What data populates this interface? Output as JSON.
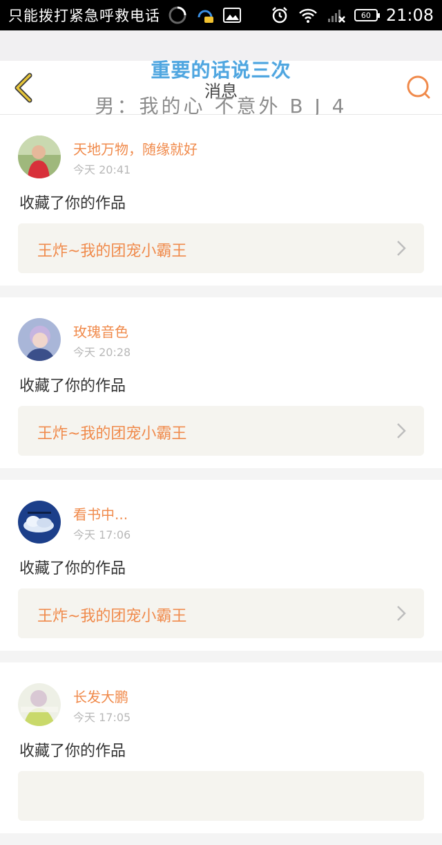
{
  "status_bar": {
    "carrier_text": "只能拨打紧急呼救电话",
    "battery": "60",
    "time": "21:08"
  },
  "header": {
    "title": "消息",
    "overlay_line1": "重要的话说三次",
    "overlay_line2": "男：我的心 不意外 B J 4"
  },
  "colors": {
    "accent": "#f08a4b",
    "back_icon": "#e6c53a"
  },
  "icons": {
    "back": "chevron-left-icon",
    "search": "search-icon"
  },
  "messages": [
    {
      "user": "天地万物，随缘就好",
      "time": "今天 20:41",
      "action": "收藏了你的作品",
      "work": "王炸~我的团宠小霸王"
    },
    {
      "user": "玫瑰音色",
      "time": "今天 20:28",
      "action": "收藏了你的作品",
      "work": "王炸~我的团宠小霸王"
    },
    {
      "user": "看书中...",
      "time": "今天 17:06",
      "action": "收藏了你的作品",
      "work": "王炸~我的团宠小霸王"
    },
    {
      "user": "长发大鹏",
      "time": "今天 17:05",
      "action": "收藏了你的作品",
      "work": ""
    }
  ]
}
